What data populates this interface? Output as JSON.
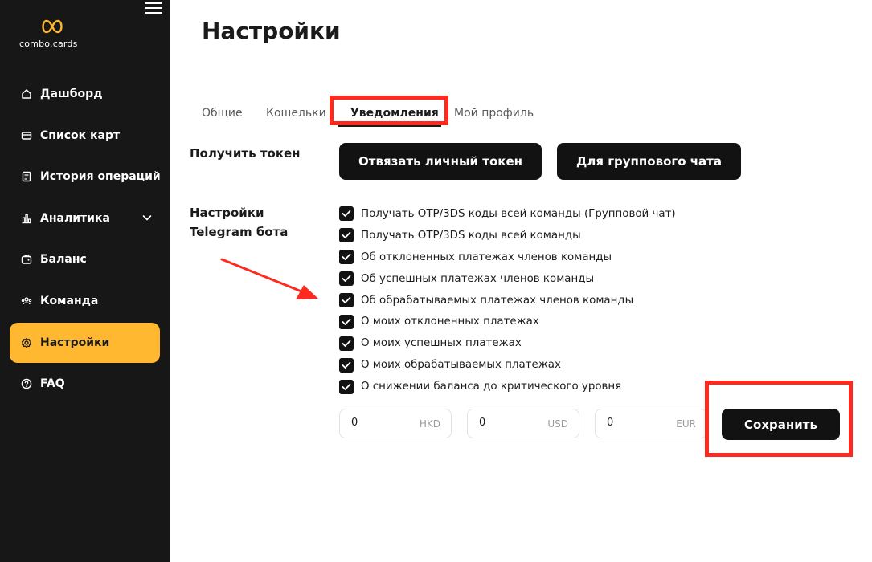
{
  "app": {
    "logo_text": "combo.cards",
    "accent_color": "#ffb830",
    "annotation_color": "#ff2a1f"
  },
  "sidebar": {
    "items": [
      {
        "label": "Дашборд",
        "icon": "home-icon"
      },
      {
        "label": "Список карт",
        "icon": "card-icon"
      },
      {
        "label": "История операций",
        "icon": "history-icon"
      },
      {
        "label": "Аналитика",
        "icon": "analytics-icon",
        "has_chevron": true
      },
      {
        "label": "Баланс",
        "icon": "wallet-icon"
      },
      {
        "label": "Команда",
        "icon": "team-icon"
      },
      {
        "label": "Настройки",
        "icon": "gear-icon",
        "active": true
      },
      {
        "label": "FAQ",
        "icon": "help-icon"
      }
    ]
  },
  "main": {
    "title": "Настройки",
    "tabs": [
      {
        "label": "Общие"
      },
      {
        "label": "Кошельки"
      },
      {
        "label": "Уведомления",
        "active": true
      },
      {
        "label": "Мой профиль"
      }
    ],
    "token": {
      "label": "Получить токен",
      "personal_button": "Отвязать личный токен",
      "group_button": "Для группового чата"
    },
    "bot": {
      "label_line1": "Настройки",
      "label_line2": "Telegram бота",
      "options": [
        {
          "label": "Получать OTP/3DS коды всей команды (Групповой чат)",
          "checked": true
        },
        {
          "label": "Получать OTP/3DS коды всей команды",
          "checked": true
        },
        {
          "label": "Об отклоненных платежах членов команды",
          "checked": true
        },
        {
          "label": "Об успешных платежах членов команды",
          "checked": true
        },
        {
          "label": "Об обрабатываемых платежах членов команды",
          "checked": true
        },
        {
          "label": "О моих отклоненных платежах",
          "checked": true
        },
        {
          "label": "О моих успешных платежах",
          "checked": true
        },
        {
          "label": "О моих обрабатываемых платежах",
          "checked": true
        },
        {
          "label": "О снижении баланса до критического уровня",
          "checked": true
        }
      ]
    },
    "thresholds": [
      {
        "value": "0",
        "currency": "HKD"
      },
      {
        "value": "0",
        "currency": "USD"
      },
      {
        "value": "0",
        "currency": "EUR"
      }
    ],
    "save_button": "Сохранить"
  }
}
